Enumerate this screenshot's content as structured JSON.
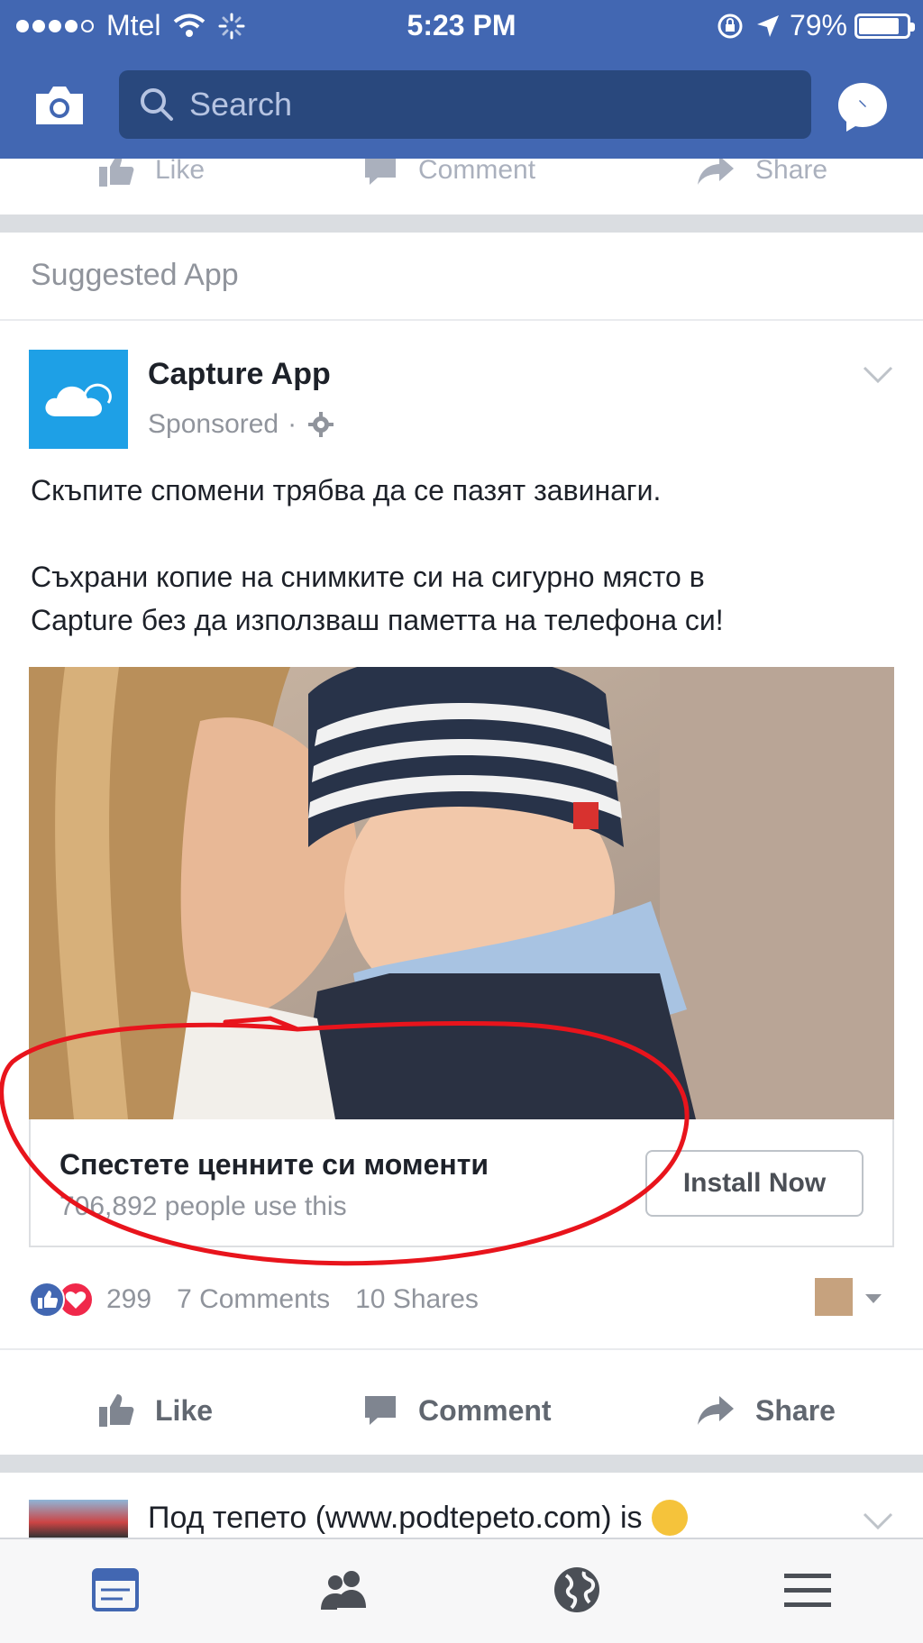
{
  "status_bar": {
    "carrier": "Mtel",
    "time": "5:23 PM",
    "battery": "79%",
    "battery_level": 0.79,
    "signal_bars": 4
  },
  "header": {
    "search_placeholder": "Search",
    "icons": [
      "camera-icon",
      "search-icon",
      "messenger-icon"
    ],
    "color": "#4267b2"
  },
  "previous_post": {
    "actions": [
      "Like",
      "Comment",
      "Share"
    ]
  },
  "suggested_label": "Suggested App",
  "post": {
    "page_name": "Capture App",
    "sponsored": "Sponsored",
    "text_line_1": "Скъпите спомени трябва да се пазят завинаги.",
    "text_line_2": "Съхрани копие на снимките си на сигурно място в",
    "text_line_3": "Capture без да използваш паметта на телефона си!",
    "ad": {
      "title": "Спестете ценните си моменти",
      "subtitle": "706,892 people use this",
      "button": "Install Now"
    },
    "reactions": {
      "count": "299",
      "comments": "7 Comments",
      "shares": "10 Shares"
    },
    "actions": {
      "like": "Like",
      "comment": "Comment",
      "share": "Share"
    }
  },
  "next_post": {
    "title": "Под тепето (www.podtepeto.com) is"
  },
  "tabbar": {
    "tabs": [
      "news-feed-icon",
      "friends-icon",
      "notifications-globe-icon",
      "menu-icon"
    ],
    "active": "news-feed-icon",
    "active_color": "#4267b2"
  },
  "annotation_color": "#e8141c"
}
